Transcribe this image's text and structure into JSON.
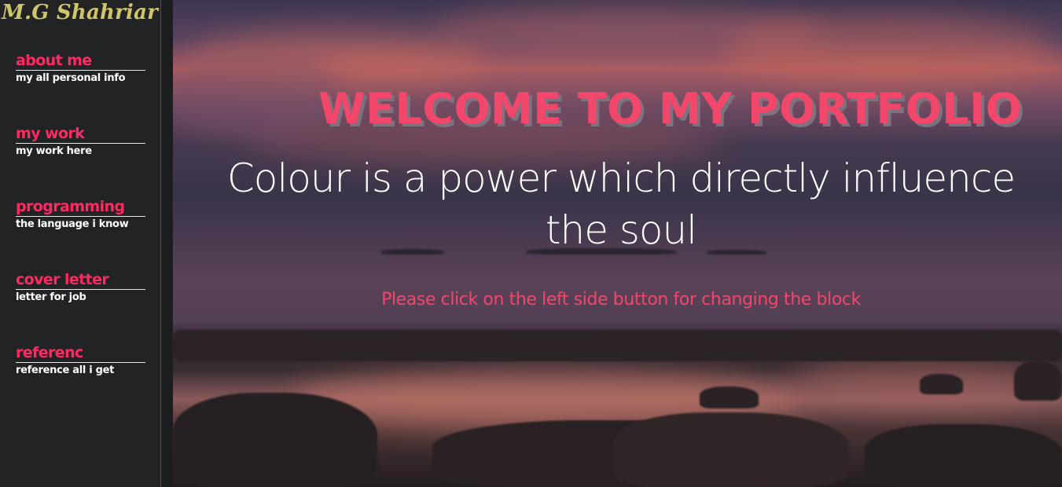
{
  "sidebar": {
    "brand": "M.G Shahriar",
    "items": [
      {
        "title": "about me",
        "subtitle": "my all personal info"
      },
      {
        "title": "my work",
        "subtitle": "my work here"
      },
      {
        "title": "programming",
        "subtitle": "the language i know"
      },
      {
        "title": "cover letter",
        "subtitle": "letter for job"
      },
      {
        "title": "referenc",
        "subtitle": "reference all i get"
      }
    ]
  },
  "hero": {
    "heading": "WELCOME TO MY PORTFOLIO",
    "quote": "Colour is a power which directly influence the soul",
    "hint": "Please click on the left side button for changing the block"
  },
  "colors": {
    "accent": "#f2476a",
    "nav_title": "#ff2a62",
    "brand": "#cfc56a",
    "sidebar_bg": "#222325"
  }
}
